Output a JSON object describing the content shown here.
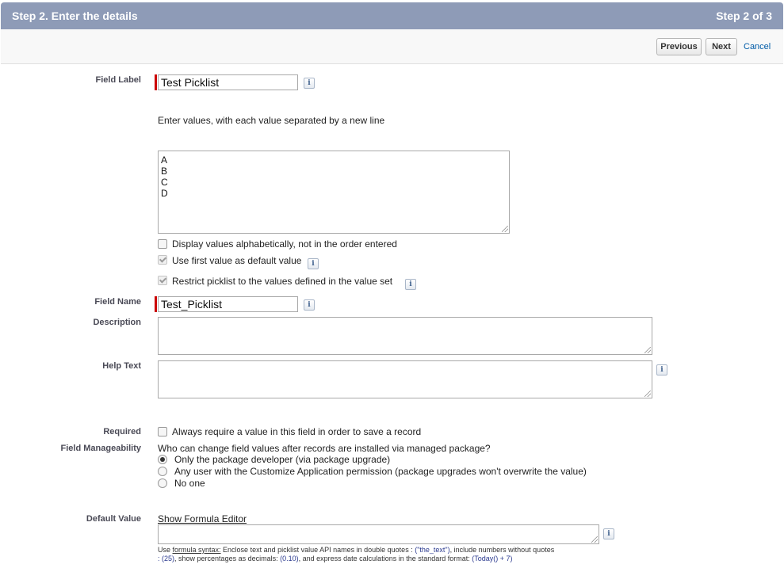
{
  "header": {
    "title": "Step 2. Enter the details",
    "step": "Step 2 of 3"
  },
  "toolbar": {
    "previous": "Previous",
    "next": "Next",
    "cancel": "Cancel"
  },
  "field_label": {
    "label": "Field Label",
    "value": "Test Picklist"
  },
  "values_section": {
    "instruction": "Enter values, with each value separated by a new line",
    "values": "A\nB\nC\nD",
    "sort_alpha": {
      "label": "Display values alphabetically, not in the order entered",
      "checked": false
    },
    "first_default": {
      "label": "Use first value as default value",
      "checked": true
    },
    "restrict": {
      "label": "Restrict picklist to the values defined in the value set",
      "checked": true
    }
  },
  "field_name": {
    "label": "Field Name",
    "value": "Test_Picklist"
  },
  "description": {
    "label": "Description",
    "value": ""
  },
  "help_text": {
    "label": "Help Text",
    "value": ""
  },
  "required": {
    "label": "Required",
    "option": "Always require a value in this field in order to save a record",
    "checked": false
  },
  "manageability": {
    "label": "Field Manageability",
    "question": "Who can change field values after records are installed via managed package?",
    "options": [
      {
        "label": "Only the package developer (via package upgrade)",
        "selected": true
      },
      {
        "label": "Any user with the Customize Application permission (package upgrades won't overwrite the value)",
        "selected": false
      },
      {
        "label": "No one",
        "selected": false
      }
    ]
  },
  "default_value": {
    "label": "Default Value",
    "link": "Show Formula Editor",
    "value": "",
    "hint": {
      "use": "Use ",
      "syntax_link": "formula syntax:",
      "part1": " Enclose text and picklist value API names in double quotes : ",
      "code1": "(\"the_text\")",
      "part2": ", include numbers without quotes",
      "line2_start": ": ",
      "code2": "(25)",
      "part3": ", show percentages as decimals: ",
      "code3": "(0.10)",
      "part4": ", and express date calculations in the standard format: ",
      "code4": "(Today() + 7)"
    }
  },
  "icons": {
    "info": "i"
  }
}
